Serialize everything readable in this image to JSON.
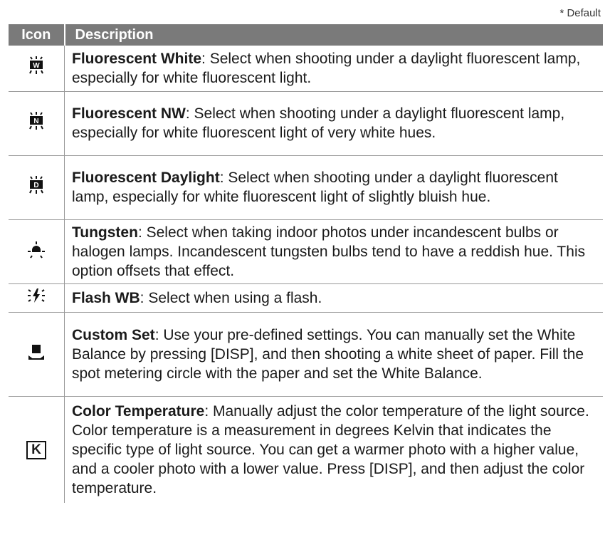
{
  "note": "* Default",
  "header": {
    "icon": "Icon",
    "description": "Description"
  },
  "rows": [
    {
      "icon": "fluorescent-white-icon",
      "glyph": "W",
      "term": "Fluorescent White",
      "text": ": Select when shooting under a daylight fluorescent lamp, especially for white fluorescent light."
    },
    {
      "icon": "fluorescent-nw-icon",
      "glyph": "N",
      "term": "Fluorescent NW",
      "text": ": Select when shooting under a daylight fluorescent lamp, especially for white fluorescent light of very white hues."
    },
    {
      "icon": "fluorescent-daylight-icon",
      "glyph": "D",
      "term": "Fluorescent Daylight",
      "text": ": Select when shooting under a daylight fluorescent lamp, especially for white fluorescent light of slightly bluish hue."
    },
    {
      "icon": "tungsten-icon",
      "term": "Tungsten",
      "text": ": Select when taking indoor photos under incandescent bulbs or halogen lamps. Incandescent tungsten bulbs tend to have a reddish hue. This option offsets that effect."
    },
    {
      "icon": "flash-wb-icon",
      "term": "Flash WB",
      "text": ": Select when using a flash."
    },
    {
      "icon": "custom-set-icon",
      "term": "Custom Set",
      "text": ": Use your pre-defined settings. You can manually set the White Balance by pressing [DISP], and then shooting a white sheet of paper. Fill the spot metering circle with the paper and set the White Balance."
    },
    {
      "icon": "color-temperature-icon",
      "glyph": "K",
      "term": "Color Temperature",
      "text": ": Manually adjust the color temperature of the light source. Color temperature is a measurement in degrees Kelvin that indicates the specific type of light source. You can get a warmer photo with a higher value, and a cooler photo with a lower value. Press [DISP], and then adjust the color temperature."
    }
  ]
}
